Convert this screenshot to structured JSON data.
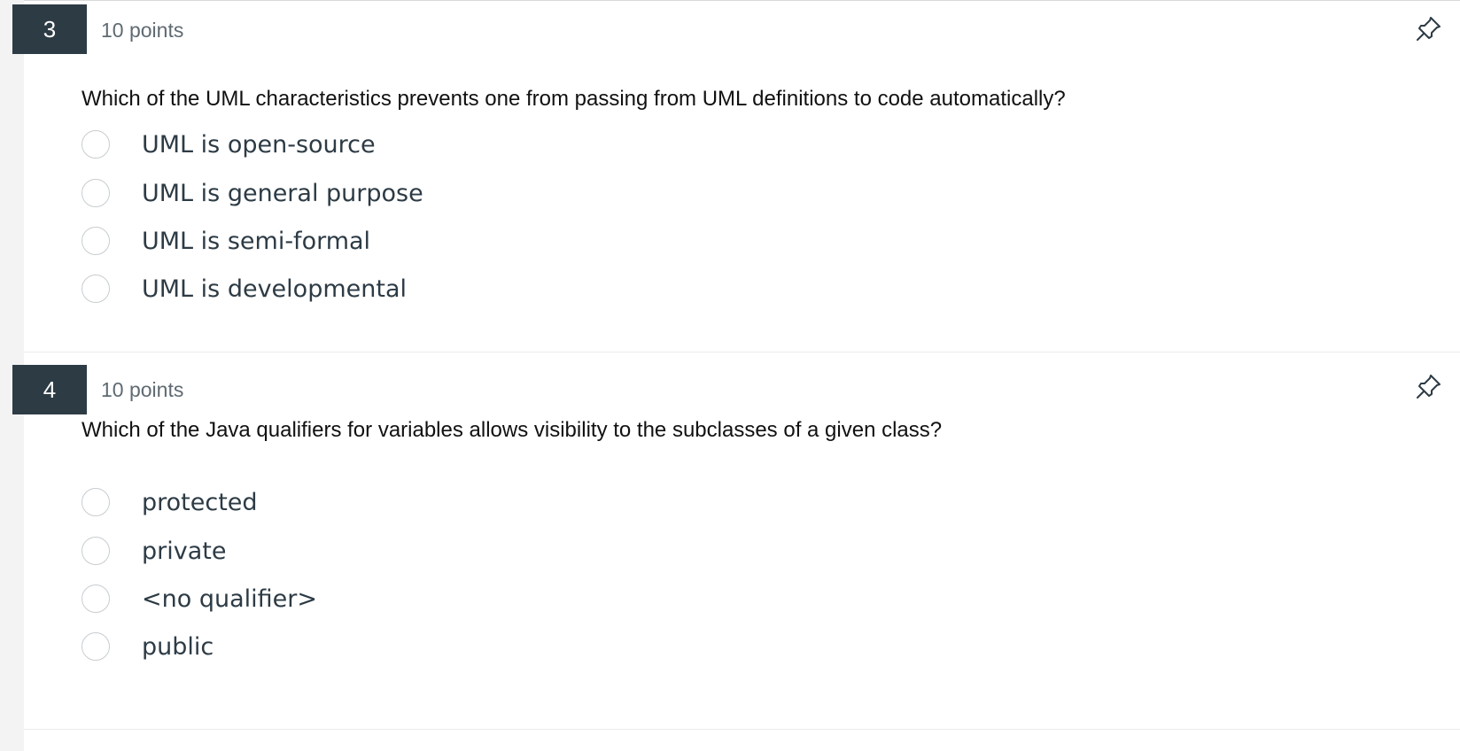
{
  "questions": [
    {
      "number": "3",
      "points": "10 points",
      "text": "Which of the UML characteristics prevents one from passing from UML definitions to code automatically?",
      "answers": [
        "UML is open-source",
        "UML is general purpose",
        "UML is semi-formal",
        "UML is developmental"
      ],
      "pin_icon": "pin-icon"
    },
    {
      "number": "4",
      "points": "10 points",
      "text": "Which of the Java qualifiers for variables allows visibility to the subclasses of a given class?",
      "answers": [
        "protected",
        "private",
        "<no qualifier>",
        "public"
      ],
      "pin_icon": "pin-icon"
    }
  ],
  "colors": {
    "number_box": "#2d3b45",
    "answer_text": "#2d3b45",
    "radio_border": "#c7cdd1",
    "points_text": "#5f6a72"
  }
}
